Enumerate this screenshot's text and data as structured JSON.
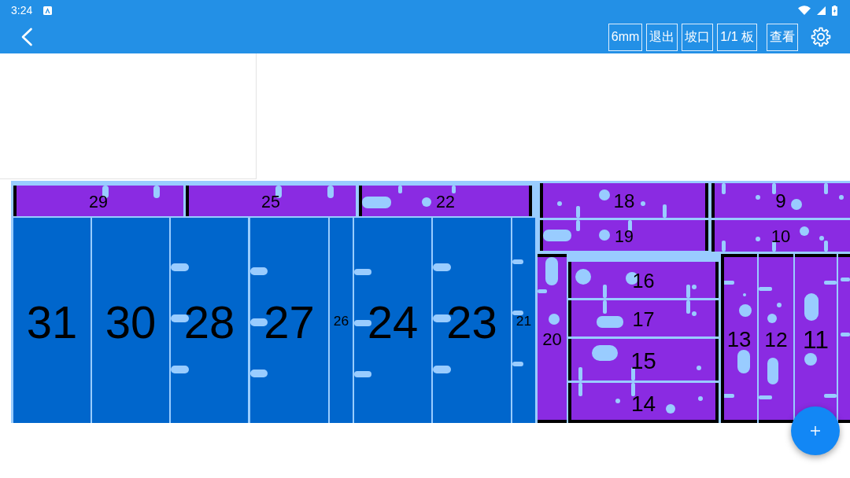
{
  "status_bar": {
    "time": "3:24"
  },
  "app_bar": {
    "buttons": [
      "6mm",
      "退出",
      "坡口",
      "1/1 板",
      "查看"
    ]
  },
  "layout": {
    "panels": [
      {
        "label": "29",
        "color": "#8a2be2",
        "bevel": {
          "left": true,
          "right": false,
          "top": false,
          "bottom": false
        }
      },
      {
        "label": "25",
        "color": "#8a2be2",
        "bevel": {
          "left": true,
          "right": false,
          "top": false,
          "bottom": false
        }
      },
      {
        "label": "22",
        "color": "#8a2be2",
        "bevel": {
          "left": true,
          "right": true,
          "top": false,
          "bottom": false
        }
      },
      {
        "label": "18",
        "color": "#8a2be2",
        "bevel": {
          "left": true,
          "right": true,
          "top": false,
          "bottom": false
        }
      },
      {
        "label": "9",
        "color": "#8a2be2",
        "bevel": {
          "left": true,
          "right": false,
          "top": false,
          "bottom": false
        }
      },
      {
        "label": "19",
        "color": "#8a2be2",
        "bevel": {
          "left": true,
          "right": true,
          "top": false,
          "bottom": false
        }
      },
      {
        "label": "10",
        "color": "#8a2be2",
        "bevel": {
          "left": true,
          "right": false,
          "top": false,
          "bottom": false
        }
      },
      {
        "label": "31",
        "color": "#0066cc",
        "bevel": {
          "left": false,
          "right": false,
          "top": false,
          "bottom": false
        }
      },
      {
        "label": "30",
        "color": "#0066cc",
        "bevel": {
          "left": false,
          "right": false,
          "top": false,
          "bottom": false
        }
      },
      {
        "label": "28",
        "color": "#0066cc",
        "bevel": {
          "left": false,
          "right": false,
          "top": false,
          "bottom": false
        }
      },
      {
        "label": "27",
        "color": "#0066cc",
        "bevel": {
          "left": false,
          "right": false,
          "top": false,
          "bottom": false
        }
      },
      {
        "label": "26",
        "color": "#0066cc",
        "bevel": {
          "left": false,
          "right": false,
          "top": false,
          "bottom": false
        }
      },
      {
        "label": "24",
        "color": "#0066cc",
        "bevel": {
          "left": false,
          "right": false,
          "top": false,
          "bottom": false
        }
      },
      {
        "label": "23",
        "color": "#0066cc",
        "bevel": {
          "left": false,
          "right": false,
          "top": false,
          "bottom": false
        }
      },
      {
        "label": "21",
        "color": "#0066cc",
        "bevel": {
          "left": false,
          "right": false,
          "top": false,
          "bottom": false
        }
      },
      {
        "label": "20",
        "color": "#8a2be2",
        "bevel": {
          "left": false,
          "right": false,
          "top": true,
          "bottom": true
        }
      },
      {
        "label": "16",
        "color": "#8a2be2",
        "bevel": {
          "left": true,
          "right": true,
          "top": false,
          "bottom": false
        }
      },
      {
        "label": "17",
        "color": "#8a2be2",
        "bevel": {
          "left": true,
          "right": true,
          "top": false,
          "bottom": false
        }
      },
      {
        "label": "15",
        "color": "#8a2be2",
        "bevel": {
          "left": true,
          "right": true,
          "top": false,
          "bottom": false
        }
      },
      {
        "label": "14",
        "color": "#8a2be2",
        "bevel": {
          "left": true,
          "right": true,
          "top": false,
          "bottom": true
        }
      },
      {
        "label": "13",
        "color": "#8a2be2",
        "bevel": {
          "left": true,
          "right": false,
          "top": true,
          "bottom": true
        }
      },
      {
        "label": "12",
        "color": "#8a2be2",
        "bevel": {
          "left": false,
          "right": false,
          "top": true,
          "bottom": true
        }
      },
      {
        "label": "11",
        "color": "#8a2be2",
        "bevel": {
          "left": false,
          "right": false,
          "top": true,
          "bottom": true
        }
      },
      {
        "color": "#8a2be2",
        "bevel": {
          "left": false,
          "right": false,
          "top": true,
          "bottom": true
        }
      }
    ]
  }
}
